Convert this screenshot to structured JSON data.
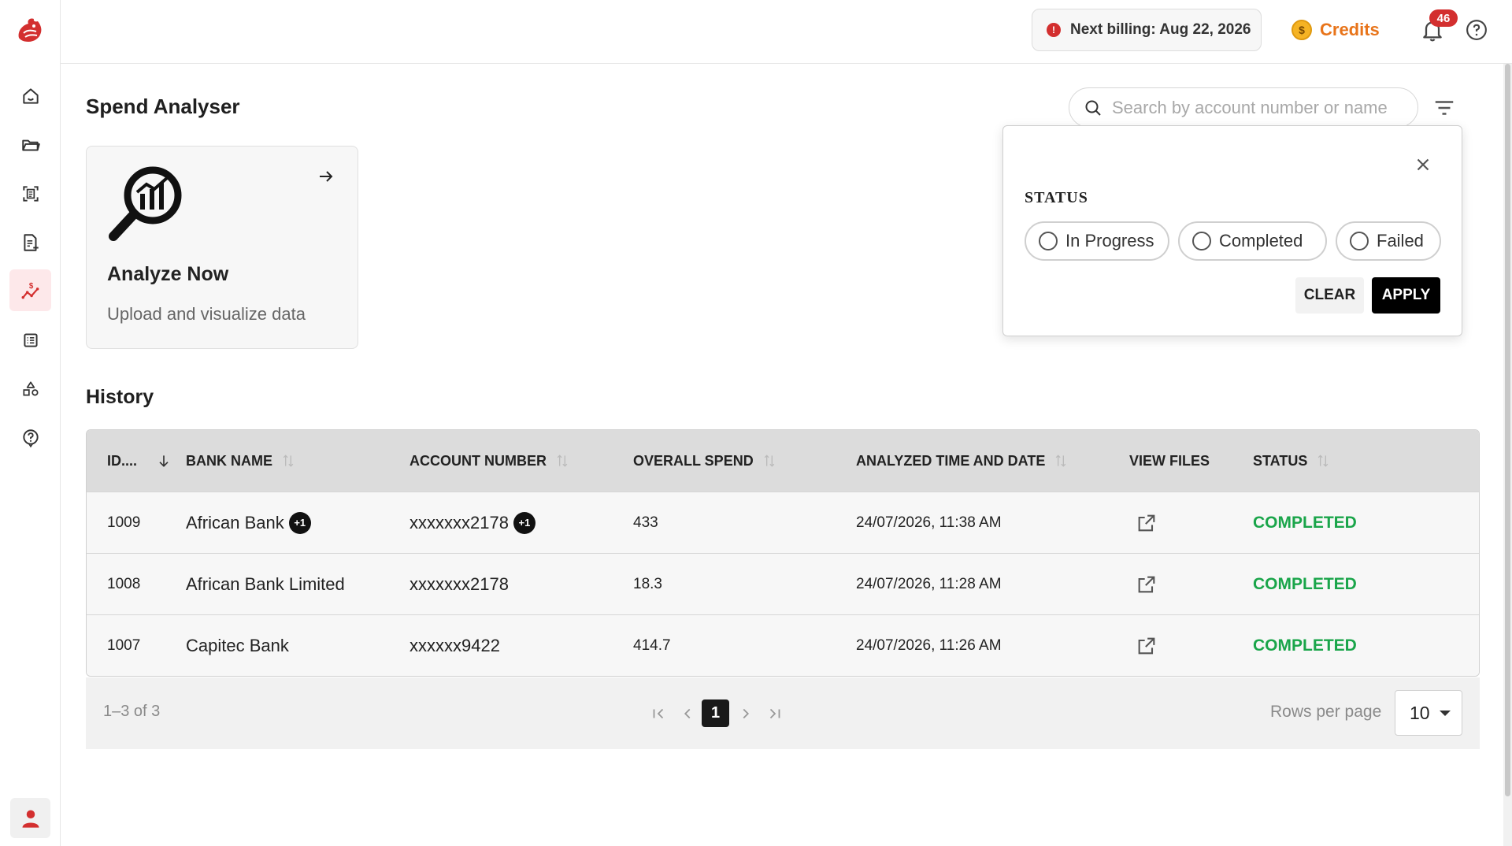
{
  "app": {
    "brand_color": "#d32f2f",
    "accent_color": "#e8741a"
  },
  "topbar": {
    "billing_text": "Next billing: Aug 22, 2026",
    "credits_label": "Credits",
    "coin_symbol": "$",
    "notification_count": "46"
  },
  "sidebar": {
    "items": [
      {
        "name": "home-icon",
        "active": false
      },
      {
        "name": "folder-icon",
        "active": false
      },
      {
        "name": "scan-document-icon",
        "active": false
      },
      {
        "name": "add-document-icon",
        "active": false
      },
      {
        "name": "spend-analyser-icon",
        "active": true
      },
      {
        "name": "list-icon",
        "active": false
      },
      {
        "name": "shapes-icon",
        "active": false
      },
      {
        "name": "help-icon",
        "active": false
      }
    ],
    "user_icon": "user-icon"
  },
  "main": {
    "page_title": "Spend Analyser",
    "search_placeholder": "Search by account number or name",
    "card": {
      "title": "Analyze Now",
      "subtitle": "Upload and visualize data"
    },
    "history_title": "History"
  },
  "table": {
    "headers": [
      "ID....",
      "BANK NAME",
      "ACCOUNT NUMBER",
      "OVERALL SPEND",
      "ANALYZED TIME AND DATE",
      "VIEW FILES",
      "STATUS"
    ],
    "rows": [
      {
        "id": "1009",
        "bank": "African Bank",
        "bank_extra": "+1",
        "account": "xxxxxxx2178",
        "account_extra": "+1",
        "spend": "433",
        "date": "24/07/2026, 11:38 AM",
        "status": "COMPLETED"
      },
      {
        "id": "1008",
        "bank": "African Bank Limited",
        "bank_extra": "",
        "account": "xxxxxxx2178",
        "account_extra": "",
        "spend": "18.3",
        "date": "24/07/2026, 11:28 AM",
        "status": "COMPLETED"
      },
      {
        "id": "1007",
        "bank": "Capitec Bank",
        "bank_extra": "",
        "account": "xxxxxx9422",
        "account_extra": "",
        "spend": "414.7",
        "date": "24/07/2026, 11:26 AM",
        "status": "COMPLETED"
      }
    ],
    "status_color": "#1aa54a"
  },
  "pagination": {
    "range_text": "1–3 of 3",
    "current_page": "1",
    "rows_per_page_label": "Rows per page",
    "rows_per_page_value": "10"
  },
  "filter_popover": {
    "section_label": "STATUS",
    "options": [
      "In Progress",
      "Completed",
      "Failed"
    ],
    "clear_label": "CLEAR",
    "apply_label": "APPLY"
  }
}
